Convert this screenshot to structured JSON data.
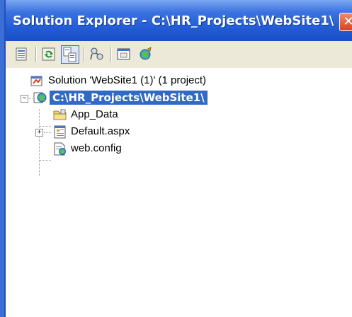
{
  "window": {
    "title": "Solution Explorer - C:\\HR_Projects\\WebSite1\\",
    "close_glyph": "✕"
  },
  "toolbar": {
    "buttons": [
      {
        "icon": "properties-icon"
      },
      {
        "icon": "refresh-icon"
      },
      {
        "icon": "nest-related-files-icon"
      },
      {
        "icon": "copy-web-site-icon"
      },
      {
        "icon": "view-designer-icon"
      },
      {
        "icon": "asp-net-configuration-icon"
      }
    ]
  },
  "tree": {
    "solution": {
      "label": "Solution 'WebSite1 (1)' (1 project)",
      "icon": "solution-icon"
    },
    "project": {
      "label": "C:\\HR_Projects\\WebSite1\\",
      "icon": "web-project-icon",
      "expander": "−"
    },
    "items": [
      {
        "label": "App_Data",
        "icon": "folder-icon"
      },
      {
        "label": "Default.aspx",
        "icon": "aspx-page-icon",
        "expander": "+"
      },
      {
        "label": "web.config",
        "icon": "config-file-icon"
      }
    ]
  },
  "colors": {
    "title_bar": "#225bd4",
    "selection": "#316ac5",
    "toolbar_bg": "#ece9d8"
  }
}
